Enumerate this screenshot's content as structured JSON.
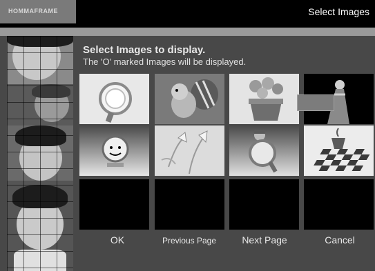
{
  "header": {
    "logo_text": "HOMMAFRAME",
    "title": "Select Images"
  },
  "instructions": {
    "title": "Select Images to display.",
    "subtitle": "The 'O' marked Images will be displayed."
  },
  "thumbnails": [
    {
      "subject": "magnifier-circle",
      "marked": true
    },
    {
      "subject": "squirrel",
      "marked": false
    },
    {
      "subject": "flower-pot",
      "marked": false
    },
    {
      "subject": "lady-in-dress",
      "marked": false
    },
    {
      "subject": "clock-character",
      "marked": true
    },
    {
      "subject": "lily-flowers",
      "marked": false
    },
    {
      "subject": "girl-with-magnifier",
      "marked": true
    },
    {
      "subject": "teacup-on-checkerboard",
      "marked": false
    },
    {
      "subject": "empty",
      "marked": false
    },
    {
      "subject": "empty",
      "marked": false
    },
    {
      "subject": "empty",
      "marked": false
    },
    {
      "subject": "empty",
      "marked": false
    }
  ],
  "buttons": {
    "ok": "OK",
    "previous": "Previous Page",
    "next": "Next Page",
    "cancel": "Cancel"
  },
  "colors": {
    "background": "#484848",
    "titlebar": "#000000",
    "text": "#e8e8e8"
  }
}
